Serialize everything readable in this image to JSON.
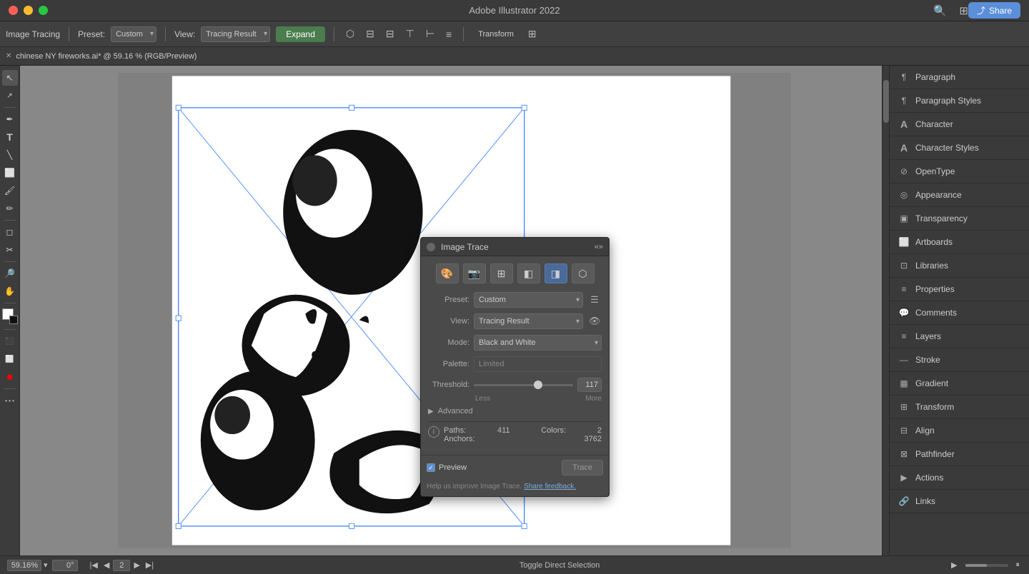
{
  "app": {
    "title": "Adobe Illustrator 2022",
    "share_label": "Share"
  },
  "toolbar": {
    "image_tracing_label": "Image Tracing",
    "preset_label": "Preset:",
    "preset_value": "Custom",
    "view_label": "View:",
    "view_value": "Tracing Result",
    "expand_label": "Expand",
    "transform_label": "Transform"
  },
  "tabbar": {
    "file_name": "chinese NY fireworks.ai* @ 59.16 % (RGB/Preview)"
  },
  "image_trace_dialog": {
    "title": "Image Trace",
    "preset_label": "Preset:",
    "preset_value": "Custom",
    "view_label": "View:",
    "view_value": "Tracing Result",
    "mode_label": "Mode:",
    "mode_value": "Black and White",
    "palette_label": "Palette:",
    "palette_value": "Limited",
    "threshold_label": "Threshold:",
    "threshold_value": "117",
    "threshold_less": "Less",
    "threshold_more": "More",
    "advanced_label": "Advanced",
    "paths_label": "Paths:",
    "paths_value": "411",
    "anchors_label": "Anchors:",
    "anchors_value": "3762",
    "colors_label": "Colors:",
    "colors_value": "2",
    "preview_label": "Preview",
    "trace_label": "Trace",
    "feedback_text": "Help us improve Image Trace.",
    "feedback_link": "Share feedback."
  },
  "right_panel": {
    "items": [
      {
        "id": "paragraph",
        "label": "Paragraph",
        "icon": "¶"
      },
      {
        "id": "paragraph-styles",
        "label": "Paragraph Styles",
        "icon": "¶"
      },
      {
        "id": "character",
        "label": "Character",
        "icon": "A"
      },
      {
        "id": "character-styles",
        "label": "Character Styles",
        "icon": "A"
      },
      {
        "id": "opentype",
        "label": "OpenType",
        "icon": "⊘"
      },
      {
        "id": "appearance",
        "label": "Appearance",
        "icon": "◎"
      },
      {
        "id": "transparency",
        "label": "Transparency",
        "icon": "▣"
      },
      {
        "id": "artboards",
        "label": "Artboards",
        "icon": "⬜"
      },
      {
        "id": "libraries",
        "label": "Libraries",
        "icon": "📚"
      },
      {
        "id": "properties",
        "label": "Properties",
        "icon": "≡"
      },
      {
        "id": "comments",
        "label": "Comments",
        "icon": "💬"
      },
      {
        "id": "layers",
        "label": "Layers",
        "icon": "≡"
      },
      {
        "id": "stroke",
        "label": "Stroke",
        "icon": "—"
      },
      {
        "id": "gradient",
        "label": "Gradient",
        "icon": "▦"
      },
      {
        "id": "transform",
        "label": "Transform",
        "icon": "⊞"
      },
      {
        "id": "align",
        "label": "Align",
        "icon": "⊟"
      },
      {
        "id": "pathfinder",
        "label": "Pathfinder",
        "icon": "⊠"
      },
      {
        "id": "actions",
        "label": "Actions",
        "icon": "▶"
      },
      {
        "id": "links",
        "label": "Links",
        "icon": "🔗"
      }
    ]
  },
  "statusbar": {
    "zoom_value": "59.16%",
    "rotation": "0°",
    "page_num": "2",
    "status_text": "Toggle Direct Selection"
  }
}
